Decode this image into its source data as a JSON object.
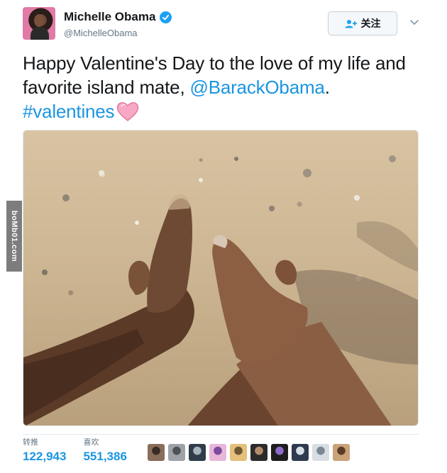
{
  "author": {
    "name": "Michelle Obama",
    "handle": "@MichelleObama",
    "verified_icon": "verified-badge-icon"
  },
  "actions": {
    "follow_label": "关注",
    "follow_icon": "add-user-icon",
    "menu_icon": "chevron-down-icon"
  },
  "tweet": {
    "text_part1": "Happy Valentine's Day to the love of my life and favorite island mate, ",
    "mention": "@BarackObama",
    "text_part2": ".",
    "hashtag": "#valentines",
    "emoji_icon": "pink-heart-emoji"
  },
  "watermark": "boMb01.com",
  "stats": {
    "retweets_label": "转推",
    "retweets_value": "122,943",
    "likes_label": "喜欢",
    "likes_value": "551,386"
  },
  "colors": {
    "link": "#1b95e0",
    "verified": "#1da1f2",
    "text": "#14171a",
    "muted": "#657786"
  },
  "liker_avatars": [
    {
      "color": "#8a6d5a",
      "accent": "#3a2c24"
    },
    {
      "color": "#9fa3a8",
      "accent": "#4e5157"
    },
    {
      "color": "#2f3d4a",
      "accent": "#a7b3bd"
    },
    {
      "color": "#e9b6d9",
      "accent": "#7c4b9d"
    },
    {
      "color": "#e4c07a",
      "accent": "#6b5734"
    },
    {
      "color": "#2b2b2b",
      "accent": "#b58c6a"
    },
    {
      "color": "#1d1d1d",
      "accent": "#8e6ac9"
    },
    {
      "color": "#2e3b4e",
      "accent": "#d9dee5"
    },
    {
      "color": "#d8dde3",
      "accent": "#7a8896"
    },
    {
      "color": "#c9a27a",
      "accent": "#5a3c24"
    }
  ]
}
